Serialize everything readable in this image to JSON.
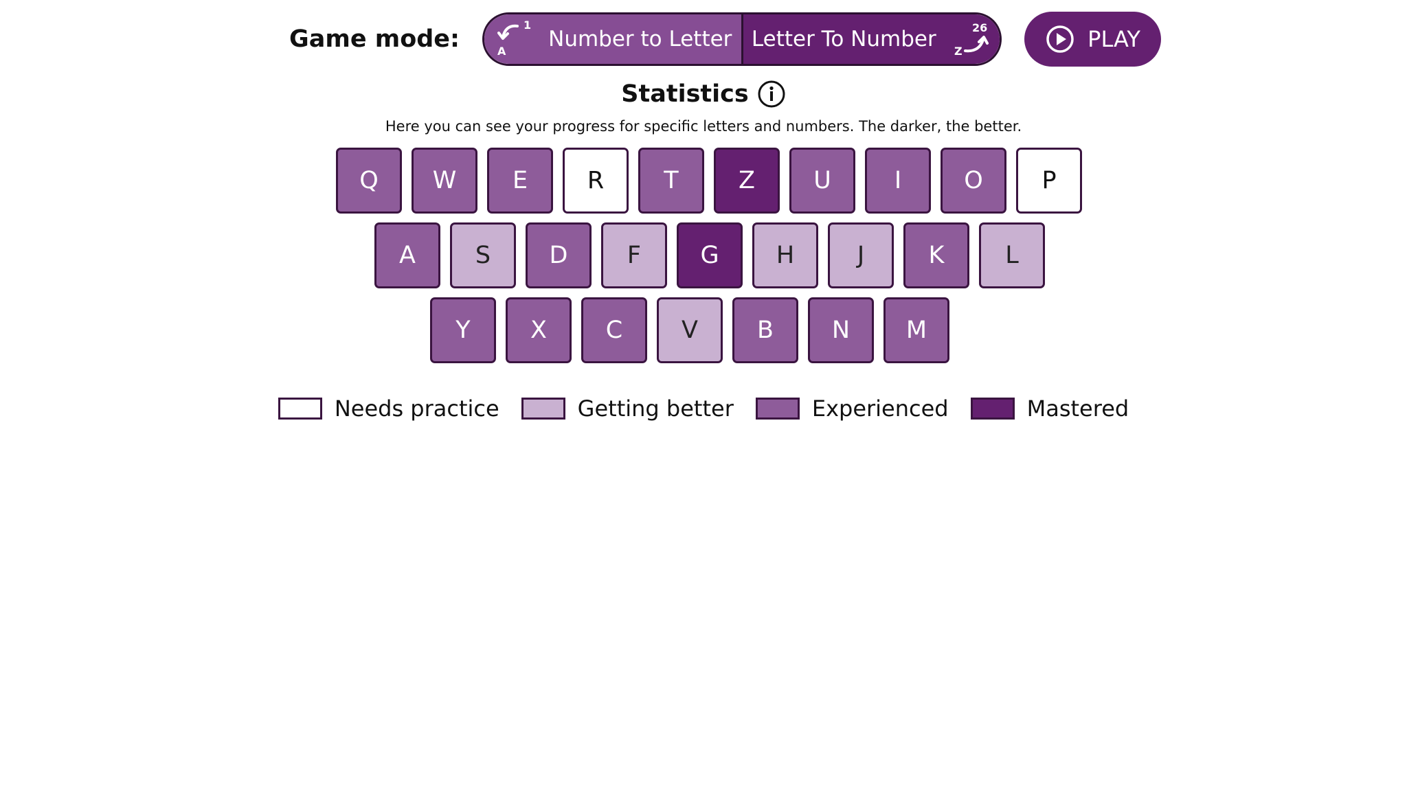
{
  "header": {
    "game_mode_label": "Game mode:",
    "modes": [
      {
        "label": "Number to Letter",
        "icon": "number-to-letter-icon",
        "icon_top": "1",
        "icon_bottom": "A",
        "color": "#864d94"
      },
      {
        "label": "Letter To Number",
        "icon": "letter-to-number-icon",
        "icon_top": "26",
        "icon_bottom": "Z",
        "color": "#642070"
      }
    ],
    "play_label": "PLAY",
    "play_icon": "play-circle-icon"
  },
  "statistics": {
    "title": "Statistics",
    "info_icon": "info-icon",
    "description": "Here you can see your progress for specific letters and numbers. The darker, the better."
  },
  "levels": {
    "needs_practice": {
      "label": "Needs practice",
      "color": "#ffffff",
      "text_color": "#111111"
    },
    "getting_better": {
      "label": "Getting better",
      "color": "#c9b1d1",
      "text_color": "#222222"
    },
    "experienced": {
      "label": "Experienced",
      "color": "#8e5c9a",
      "text_color": "#ffffff"
    },
    "mastered": {
      "label": "Mastered",
      "color": "#642070",
      "text_color": "#ffffff"
    }
  },
  "legend_order": [
    "needs_practice",
    "getting_better",
    "experienced",
    "mastered"
  ],
  "keyboard": {
    "rows": [
      [
        {
          "letter": "Q",
          "level": "experienced"
        },
        {
          "letter": "W",
          "level": "experienced"
        },
        {
          "letter": "E",
          "level": "experienced"
        },
        {
          "letter": "R",
          "level": "needs_practice"
        },
        {
          "letter": "T",
          "level": "experienced"
        },
        {
          "letter": "Z",
          "level": "mastered"
        },
        {
          "letter": "U",
          "level": "experienced"
        },
        {
          "letter": "I",
          "level": "experienced"
        },
        {
          "letter": "O",
          "level": "experienced"
        },
        {
          "letter": "P",
          "level": "needs_practice"
        }
      ],
      [
        {
          "letter": "A",
          "level": "experienced"
        },
        {
          "letter": "S",
          "level": "getting_better"
        },
        {
          "letter": "D",
          "level": "experienced"
        },
        {
          "letter": "F",
          "level": "getting_better"
        },
        {
          "letter": "G",
          "level": "mastered"
        },
        {
          "letter": "H",
          "level": "getting_better"
        },
        {
          "letter": "J",
          "level": "getting_better"
        },
        {
          "letter": "K",
          "level": "experienced"
        },
        {
          "letter": "L",
          "level": "getting_better"
        }
      ],
      [
        {
          "letter": "Y",
          "level": "experienced"
        },
        {
          "letter": "X",
          "level": "experienced"
        },
        {
          "letter": "C",
          "level": "experienced"
        },
        {
          "letter": "V",
          "level": "getting_better"
        },
        {
          "letter": "B",
          "level": "experienced"
        },
        {
          "letter": "N",
          "level": "experienced"
        },
        {
          "letter": "M",
          "level": "experienced"
        }
      ]
    ]
  }
}
